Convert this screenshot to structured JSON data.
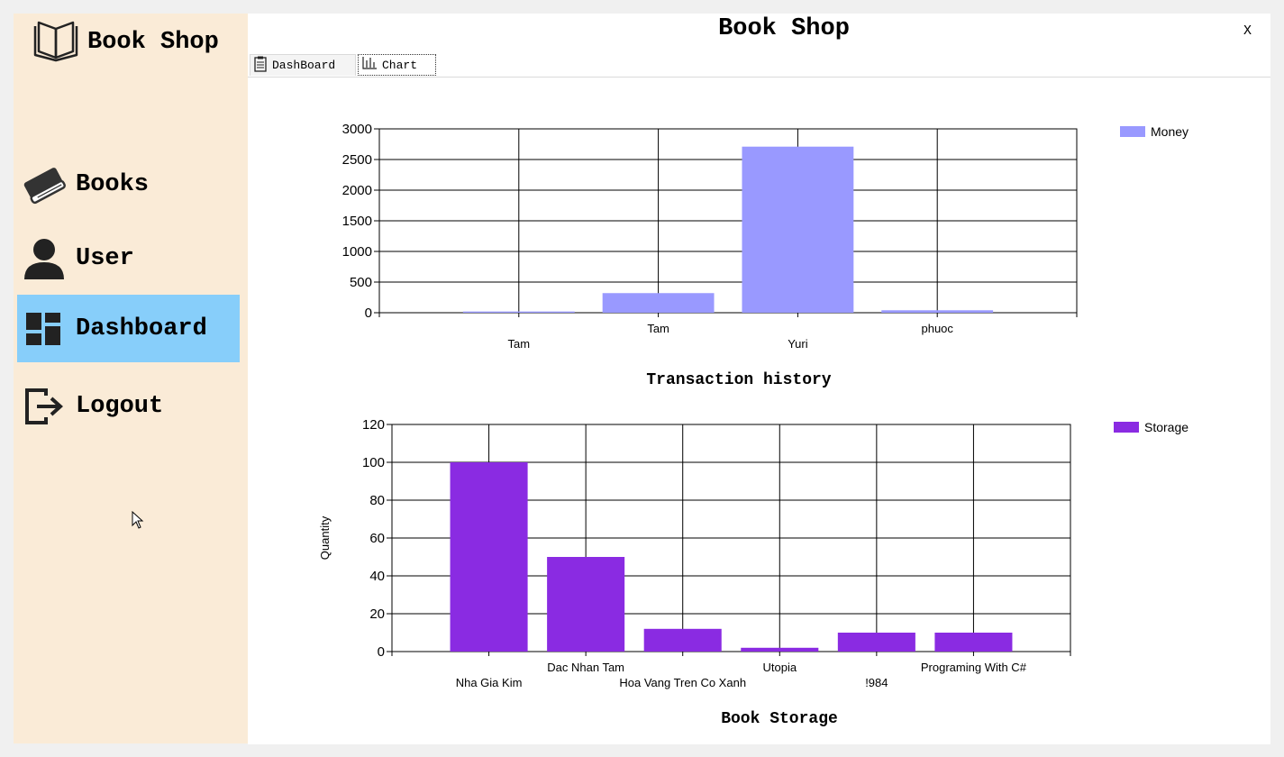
{
  "app": {
    "logo_text": "Book Shop",
    "window_title": "Book Shop",
    "close_label": "X"
  },
  "sidebar": {
    "items": [
      {
        "label": "Books",
        "icon": "book-icon",
        "active": false
      },
      {
        "label": "User",
        "icon": "user-icon",
        "active": false
      },
      {
        "label": "Dashboard",
        "icon": "dashboard-icon",
        "active": true
      },
      {
        "label": "Logout",
        "icon": "logout-icon",
        "active": false
      }
    ]
  },
  "tabs": [
    {
      "label": "DashBoard",
      "icon": "clipboard-icon",
      "selected": false
    },
    {
      "label": "Chart",
      "icon": "bar-chart-icon",
      "selected": true
    }
  ],
  "colors": {
    "sidebar_bg": "#faebd7",
    "active_bg": "#87cefa",
    "money_series": "#9999ff",
    "storage_series": "#8a2be2"
  },
  "chart_data": [
    {
      "type": "bar",
      "title": "Transaction history",
      "categories": [
        "Tam",
        "Tam",
        "Yuri",
        "phuoc"
      ],
      "series": [
        {
          "name": "Money",
          "values": [
            20,
            320,
            2710,
            40
          ]
        }
      ],
      "ylim": [
        0,
        3000
      ],
      "yticks": [
        0,
        500,
        1000,
        1500,
        2000,
        2500,
        3000
      ],
      "xlabel": "",
      "ylabel": "",
      "grid": true,
      "legend": "top-right"
    },
    {
      "type": "bar",
      "title": "Book Storage",
      "categories": [
        "Nha Gia Kim",
        "Dac Nhan Tam",
        "Hoa Vang Tren Co Xanh",
        "Utopia",
        "!984",
        "Programing With C#"
      ],
      "series": [
        {
          "name": "Storage",
          "values": [
            100,
            50,
            12,
            2,
            10,
            10
          ]
        }
      ],
      "ylim": [
        0,
        120
      ],
      "yticks": [
        0,
        20,
        40,
        60,
        80,
        100,
        120
      ],
      "xlabel": "",
      "ylabel": "Quantity",
      "grid": true,
      "legend": "top-right"
    }
  ]
}
